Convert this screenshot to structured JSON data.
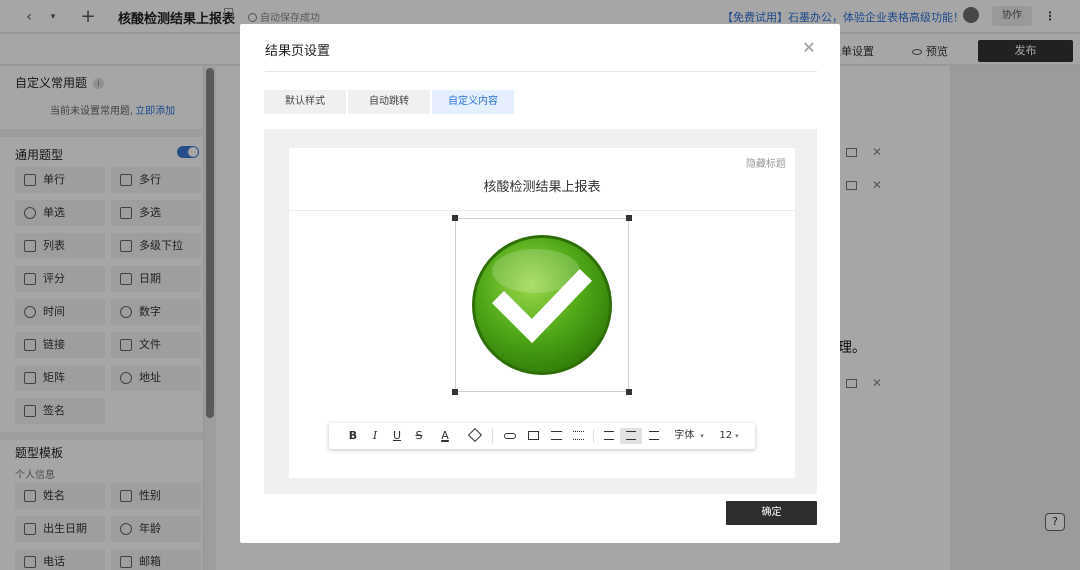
{
  "topbar": {
    "back_glyph": "‹",
    "dropdown_glyph": "▾",
    "add_glyph": "+",
    "title": "核酸检测结果上报表",
    "autosave": "自动保存成功",
    "promo": "【免费试用】石墨办公，体验企业表格高级功能！",
    "collab": "协作",
    "more_glyph": "⋮"
  },
  "bar2": {
    "form_settings": "表单设置",
    "preview": "预览",
    "publish": "发布"
  },
  "sidebar": {
    "favorites_title": "自定义常用题",
    "favorites_info": "i",
    "favorites_empty": "当前未设置常用题,",
    "favorites_add": "立即添加",
    "general_title": "通用题型",
    "fields": [
      {
        "label": "单行",
        "icon": "single-line-icon"
      },
      {
        "label": "多行",
        "icon": "multi-line-icon"
      },
      {
        "label": "单选",
        "icon": "radio-icon"
      },
      {
        "label": "多选",
        "icon": "checkbox-icon"
      },
      {
        "label": "列表",
        "icon": "list-icon"
      },
      {
        "label": "多级下拉",
        "icon": "cascade-icon"
      },
      {
        "label": "评分",
        "icon": "star-icon"
      },
      {
        "label": "日期",
        "icon": "calendar-icon"
      },
      {
        "label": "时间",
        "icon": "clock-icon"
      },
      {
        "label": "数字",
        "icon": "hash-icon"
      },
      {
        "label": "链接",
        "icon": "link-icon"
      },
      {
        "label": "文件",
        "icon": "paperclip-icon"
      },
      {
        "label": "矩阵",
        "icon": "grid-icon"
      },
      {
        "label": "地址",
        "icon": "location-icon"
      },
      {
        "label": "签名",
        "icon": "pen-icon"
      }
    ],
    "template_title": "题型模板",
    "personal_info": "个人信息",
    "templates": [
      {
        "label": "姓名",
        "icon": "person-icon"
      },
      {
        "label": "性别",
        "icon": "gender-icon"
      },
      {
        "label": "出生日期",
        "icon": "calendar-icon"
      },
      {
        "label": "年龄",
        "icon": "age-icon"
      },
      {
        "label": "电话",
        "icon": "phone-icon"
      },
      {
        "label": "邮箱",
        "icon": "mail-icon"
      }
    ]
  },
  "background": {
    "partial_text": "理。",
    "close_glyph": "✕",
    "help_glyph": "?"
  },
  "modal": {
    "title": "结果页设置",
    "close_glyph": "✕",
    "tabs": [
      {
        "label": "默认样式",
        "active": false
      },
      {
        "label": "自动跳转",
        "active": false
      },
      {
        "label": "自定义内容",
        "active": true
      }
    ],
    "hide_title": "隐藏标题",
    "card_title": "核酸检测结果上报表",
    "toolbar": {
      "bold": "B",
      "italic": "I",
      "underline": "U",
      "strike": "S",
      "font_color": "A",
      "font_label": "字体",
      "font_size": "12"
    },
    "confirm": "确定"
  },
  "colors": {
    "accent": "#2f72d8",
    "check_green": "#4fa817",
    "dark_button": "#2e2e2e"
  }
}
